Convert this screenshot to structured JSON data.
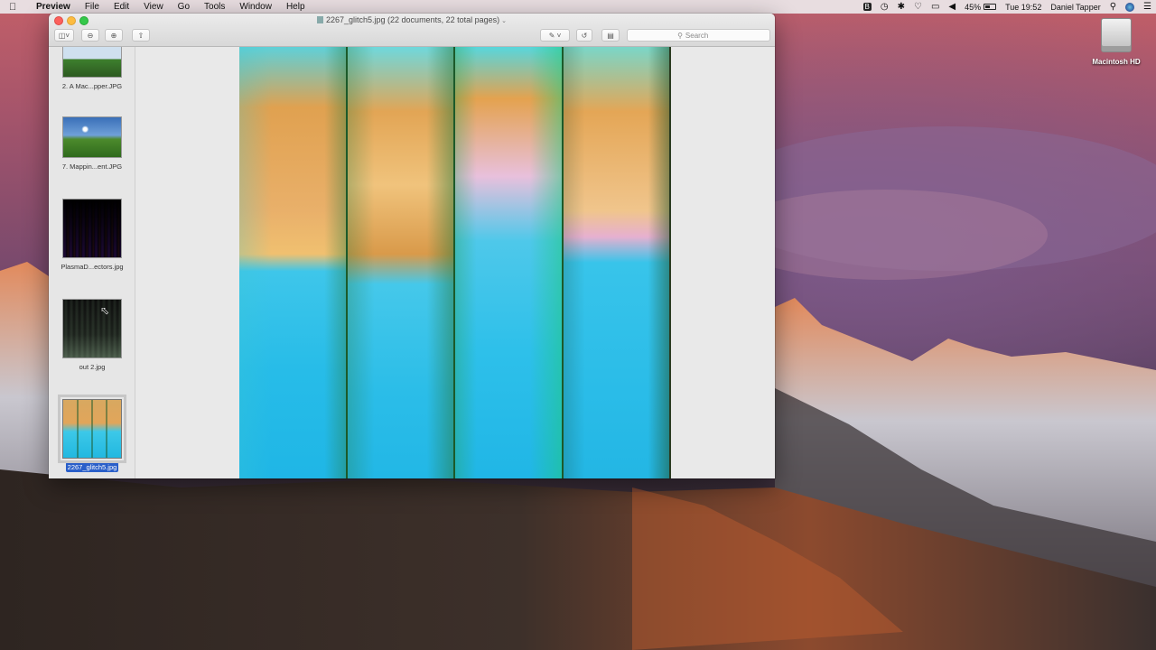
{
  "menubar": {
    "app_name": "Preview",
    "items": [
      "File",
      "Edit",
      "View",
      "Go",
      "Tools",
      "Window",
      "Help"
    ],
    "battery_percent": "45%",
    "battery_level": 0.45,
    "clock": "Tue 19:52",
    "user": "Daniel Tapper"
  },
  "desktop": {
    "drive_label": "Macintosh HD"
  },
  "window": {
    "title": "2267_glitch5.jpg (22 documents, 22 total pages)",
    "search_placeholder": "Search"
  },
  "sidebar": {
    "thumbnails": [
      {
        "caption": "2. A Mac...pper.JPG",
        "selected": false
      },
      {
        "caption": "7. Mappin...ent.JPG",
        "selected": false
      },
      {
        "caption": "PlasmaD...ectors.jpg",
        "selected": false
      },
      {
        "caption": "out 2.jpg",
        "selected": false
      },
      {
        "caption": "2267_glitch5.jpg",
        "selected": true
      }
    ]
  },
  "colors": {
    "selection_blue": "#2a5fc9",
    "close": "#fc605c",
    "minimize": "#fdbc40",
    "maximize": "#34c84a"
  }
}
